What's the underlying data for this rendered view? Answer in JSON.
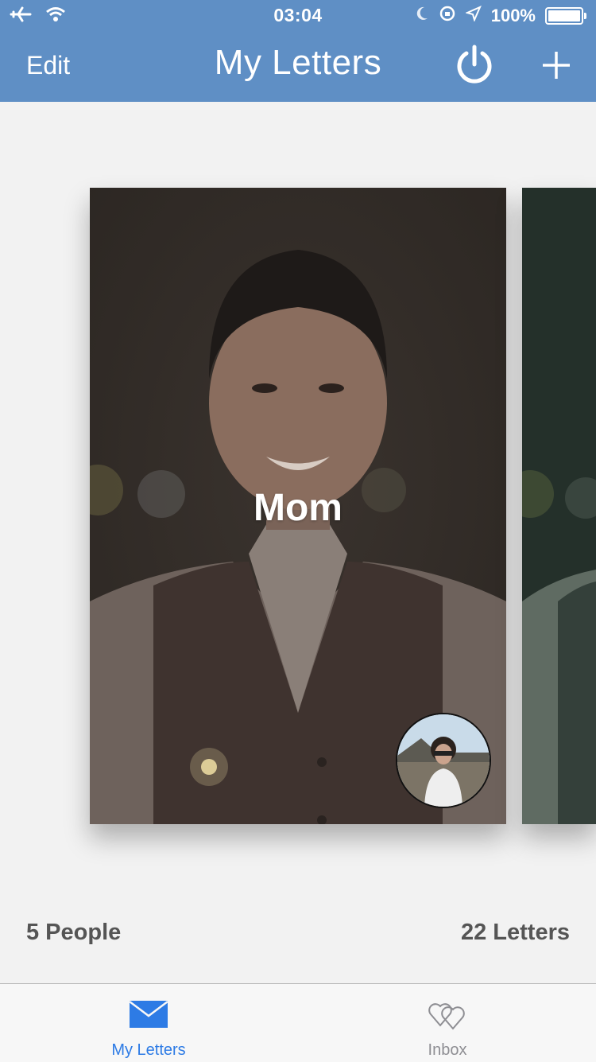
{
  "status_bar": {
    "time": "03:04",
    "battery_percent": "100%"
  },
  "nav": {
    "edit_label": "Edit",
    "title": "My Letters"
  },
  "cards": [
    {
      "name": "Mom"
    }
  ],
  "summary": {
    "people": "5 People",
    "letters": "22 Letters"
  },
  "tabs": [
    {
      "label": "My Letters",
      "selected": true
    },
    {
      "label": "Inbox",
      "selected": false
    }
  ],
  "colors": {
    "nav_bg": "#5f8fc5",
    "tab_active": "#2d7be5",
    "tab_inactive": "#8e8e93",
    "page_bg": "#f2f2f2"
  }
}
